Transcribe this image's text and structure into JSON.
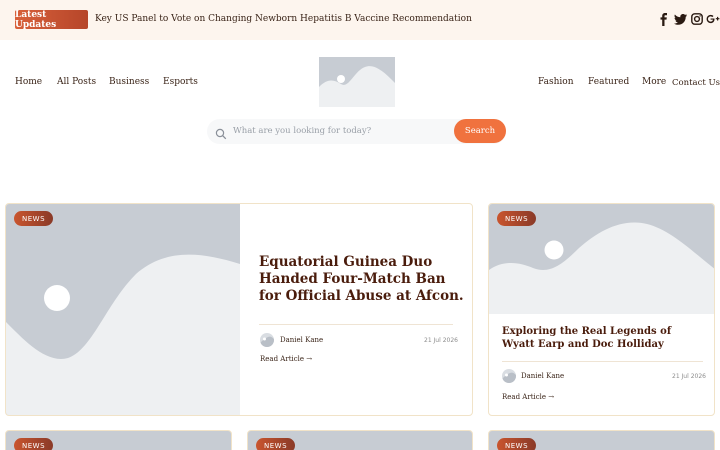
{
  "topbar": {
    "updates_label": "Latest Updates",
    "headline": "Key US Panel to Vote on Changing Newborn Hepatitis B Vaccine Recommendation",
    "social_icons": [
      "facebook-icon",
      "twitter-icon",
      "instagram-icon",
      "google-plus-icon"
    ]
  },
  "nav": {
    "left": [
      "Home",
      "All Posts",
      "Business",
      "Esports"
    ],
    "right": [
      "Fashion",
      "Featured",
      "More",
      "Contact Us"
    ]
  },
  "search": {
    "placeholder": "What are you looking for today?",
    "button_label": "Search"
  },
  "cards": [
    {
      "badge": "NEWS",
      "title": "Equatorial Guinea Duo Handed Four-Match Ban for Official Abuse at Afcon.",
      "author": "Daniel Kane",
      "date": "21 Jul 2026",
      "read_more": "Read Article →"
    },
    {
      "badge": "NEWS",
      "title": "Exploring the Real Legends of Wyatt Earp and Doc Holliday",
      "author": "Daniel Kane",
      "date": "21 Jul 2026",
      "read_more": "Read Article →"
    },
    {
      "badge": "NEWS"
    },
    {
      "badge": "NEWS"
    },
    {
      "badge": "NEWS"
    }
  ],
  "colors": {
    "accent": "#f0723e",
    "badge": "#b6462a",
    "topbar_bg": "#fdf5ee",
    "placeholder_image": "#c7ccd3",
    "title_text": "#4a1c0c"
  }
}
